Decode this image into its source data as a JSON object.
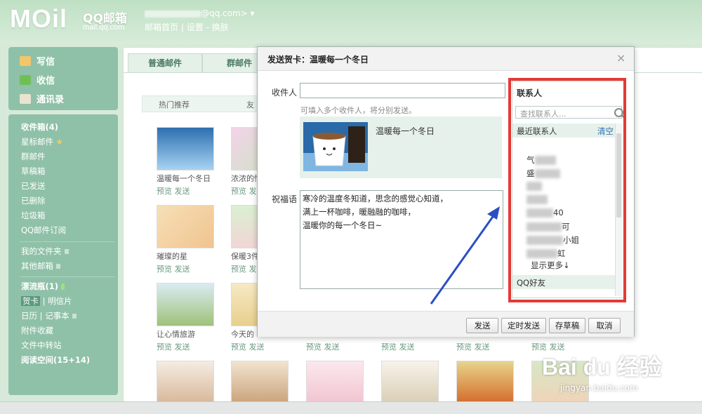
{
  "header": {
    "logo": "MOil",
    "brand": "QQ邮箱",
    "brand_sub": "mail.qq.com",
    "user_email": "@qq.com>",
    "links": [
      "邮箱首页",
      "设置",
      "换肤"
    ]
  },
  "sidebar": {
    "compose": "写信",
    "inbox": "收信",
    "contacts": "通讯录",
    "folders": [
      "收件箱(4)",
      "星标邮件",
      "群邮件",
      "草稿箱",
      "已发送",
      "已删除",
      "垃圾箱",
      "QQ邮件订阅"
    ],
    "my_folders": "我的文件夹",
    "other_mailbox": "其他邮箱",
    "drift_bottle": "漂流瓶(1)",
    "card": "贺卡",
    "postcard": "明信片",
    "calendar": "日历",
    "notebook": "记事本",
    "attachments": "附件收藏",
    "file_transfer": "文件中转站",
    "reading": "阅读空间(15+14)"
  },
  "main": {
    "tabs": [
      "普通邮件",
      "群邮件"
    ],
    "subtabs": [
      "热门推荐",
      "友"
    ],
    "cards": [
      {
        "name": "温暖每一个冬日"
      },
      {
        "name": "浓浓的情"
      },
      {
        "name": "璀璨的星"
      },
      {
        "name": "保暖3件"
      },
      {
        "name": "让心情旅游"
      },
      {
        "name": "今天的"
      }
    ],
    "preview": "预览",
    "send": "发送"
  },
  "dialog": {
    "title": "发送贺卡：温暖每一个冬日",
    "close": "×",
    "recipient_label": "收件人",
    "recipient_value": "",
    "recipient_hint": "可填入多个收件人，将分别发送。",
    "card_name": "温暖每一个冬日",
    "message_label": "祝福语",
    "message": "寒冷的温度冬知道，思念的感觉心知道，\n满上一杯咖啡，暖融融的咖啡，\n温暖你的每一个冬日~",
    "buttons": {
      "send": "发送",
      "schedule": "定时发送",
      "draft": "存草稿",
      "cancel": "取消"
    }
  },
  "contacts": {
    "title": "联系人",
    "search_placeholder": "查找联系人...",
    "recent_title": "最近联系人",
    "clear": "清空",
    "list": [
      "气",
      "盛",
      "",
      "",
      "40",
      "可",
      "小姐",
      "虹"
    ],
    "show_more": "显示更多↓",
    "qq_friends": "QQ好友"
  },
  "watermark": {
    "text": "Bai du 经验",
    "sub": "jingyan.baidu.com"
  },
  "colors": {
    "sidebar": "#8fc1a8",
    "highlight": "#e53935",
    "arrow": "#2b4fc2"
  }
}
